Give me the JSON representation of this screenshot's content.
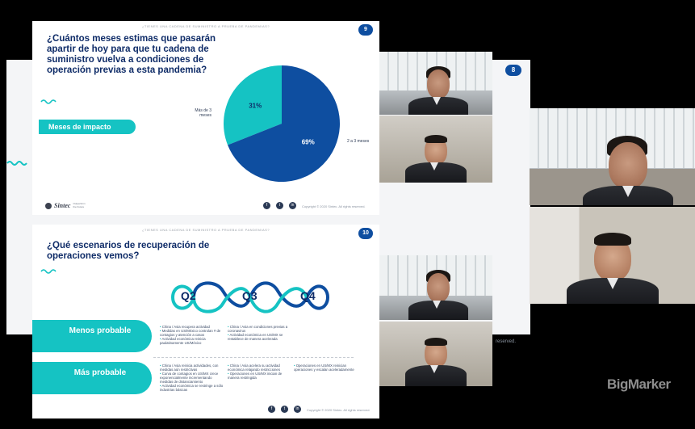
{
  "slide9": {
    "header": "¿TIENES UNA CADENA DE SUMINISTRO A PRUEBA DE PANDEMIAS?",
    "number": "9",
    "question": "¿Cuántos meses estimas que pasarán apartir de hoy para que tu cadena de suministro vuelva a condiciones de operación previas a esta pandemia?",
    "pill_label": "Meses de impacto",
    "logo_text": "Sintec",
    "logo_tagline": "Outperform the Future",
    "copyright": "Copyright © 2020 Sintec. All rights reserved."
  },
  "slide10": {
    "header": "¿TIENES UNA CADENA DE SUMINISTRO A PRUEBA DE PANDEMIAS?",
    "number": "10",
    "question": "¿Qué escenarios de recuperación de operaciones vemos?",
    "q_labels": [
      "Q2",
      "Q3",
      "Q4"
    ],
    "row1_label": "Menos probable",
    "row2_label": "Más probable",
    "row1_col1": [
      "China / Asia recupera actividad",
      "Medidas en US/México controlan # de contagios y atención a casos",
      "Actividad económica reinicia paulatinamente US/México"
    ],
    "row1_col2": [
      "China / Asia en condiciones previas a coronavirus",
      "Actividad económica en US/MX se restablece de manera acelerada"
    ],
    "row2_col1": [
      "China / Asia reinicia actividades, con medidas aún restrictivas",
      "Curva de contagios en US/MX crece exponencialmente incrementando medidas de distanciamiento",
      "Actividad económica se restringe a sólo industrias básicas"
    ],
    "row2_col2": [
      "China / Asia acelera su actividad económica relajando restricciones",
      "Operaciones en US/MX inician de manera restringida"
    ],
    "row2_col3": [
      "Operaciones en US/MX reinician operaciones y escalan aceleradamente"
    ],
    "copyright": "Copyright © 2020 Sintec. All rights reserved."
  },
  "bg_slide": {
    "number": "8",
    "reserved_text": "reserved."
  },
  "brand": {
    "watermark": "BigMarker"
  },
  "chart_data": {
    "type": "pie",
    "categories": [
      "Más de 3 meses",
      "2 a 3 meses"
    ],
    "values": [
      31,
      69
    ],
    "value_labels": [
      "31%",
      "69%"
    ],
    "colors": [
      "#15c3c3",
      "#0e4ea0"
    ]
  },
  "colors": {
    "navy": "#0f2c68",
    "teal": "#15c3c3",
    "blue": "#0e4ea0"
  }
}
